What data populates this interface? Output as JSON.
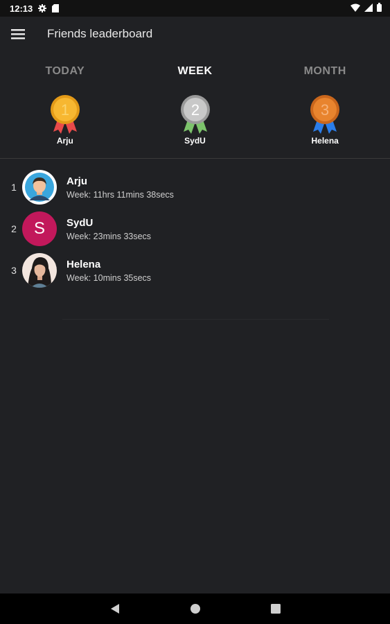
{
  "status_bar": {
    "time": "12:13",
    "icons": [
      "gear-icon",
      "sd-card-icon",
      "wifi-icon",
      "cell-signal-icon",
      "battery-icon"
    ]
  },
  "app_bar": {
    "title": "Friends leaderboard",
    "menu_icon": "hamburger-menu-icon"
  },
  "tabs": [
    {
      "label": "TODAY",
      "active": false
    },
    {
      "label": "WEEK",
      "active": true
    },
    {
      "label": "MONTH",
      "active": false
    }
  ],
  "podium": [
    {
      "place": "1",
      "name": "Arju",
      "medal_color": "#f7b731",
      "ribbon_color": "#e84a4a"
    },
    {
      "place": "2",
      "name": "SydU",
      "medal_color": "#b8b8b8",
      "ribbon_color": "#7cc36b"
    },
    {
      "place": "3",
      "name": "Helena",
      "medal_color": "#e8842e",
      "ribbon_color": "#2b7de9"
    }
  ],
  "leaderboard": [
    {
      "rank": "1",
      "name": "Arju",
      "detail": "Week: 11hrs 11mins 38secs",
      "avatar": "male-avatar-icon"
    },
    {
      "rank": "2",
      "name": "SydU",
      "detail": "Week: 23mins 33secs",
      "avatar_letter": "S",
      "avatar_color": "#c2185b"
    },
    {
      "rank": "3",
      "name": "Helena",
      "detail": "Week: 10mins 35secs",
      "avatar": "female-avatar-icon"
    }
  ],
  "nav_bar": {
    "icons": [
      "back-icon",
      "home-icon",
      "recents-icon"
    ]
  }
}
